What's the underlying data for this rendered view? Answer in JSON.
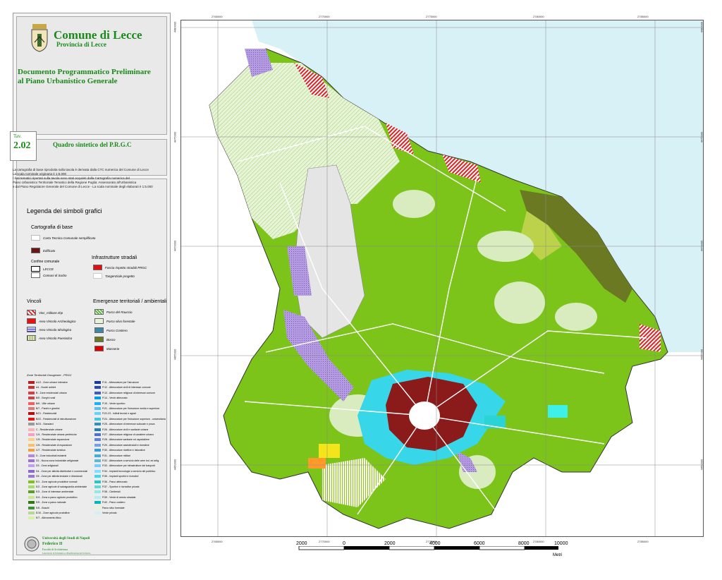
{
  "header": {
    "comune": "Comune di Lecce",
    "provincia": "Provincia di Lecce",
    "documento": "Documento Programmatico Preliminare al Piano Urbanistico Generale"
  },
  "tavola": {
    "label": "Tav.",
    "number": "2.02",
    "title": "Quadro sintetico del P.R.G.C"
  },
  "notes": {
    "line1": "La cartografia di base riprodotta sulla tavola è derivata dalla CTC numerica del Comune di Lecce",
    "line2": "La scala nominale originaria è 1:5.000",
    "line3": "I dati tematici riportati sulla tavola sono stati acquisiti dalla Cartografia numerica del",
    "line4": "Piano Urbanistico Territoriale Tematico della Regione Puglia: Assessorato all'Urbanistica",
    "line5": "e dal Piano Regolatore Generale del Comune di Lecce - La scala nominale degli elaborati è 1:5.000"
  },
  "legend": {
    "title": "Legenda dei simboli grafici",
    "cartografia": {
      "title": "Cartografia di base",
      "items": [
        "Carta Tecnica Comunale semplificata",
        "Edificato"
      ]
    },
    "confine": {
      "title": "Confine comunale",
      "items": [
        "LECCE",
        "Comuni di Surbo"
      ]
    },
    "infrastrutture": {
      "title": "Infrastrutture stradali",
      "items": [
        "Fascia rispetto stradali PRGC",
        "Tangenziale progetto"
      ]
    },
    "vincoli": {
      "title": "Vincoli",
      "items": [
        "Vinc_militare.shp",
        "Area Vincolo Archeologico",
        "Area Vincolo Idrologico",
        "Area Vincolo Paesistico"
      ]
    },
    "emergenze": {
      "title": "Emergenze territoriali / ambientali",
      "items": [
        "Parco del Rauccio",
        "Parco silvo forestale",
        "Parco Costiero",
        "Bosco",
        "Masserie"
      ]
    },
    "zone_title": "Zone Territoriali Omogenee - PRGC",
    "zone_left": [
      "A1/2 - Zone urbane intensive",
      "A4 - Nuclei antichi",
      "B - Zone residenziali urbane",
      "B/5 - Borghi rurali",
      "B/6 - Ville urbane",
      "B/7 - Parchi e giardini",
      "B/21 - Residenziali",
      "B/22 - Residenziali di ristrutturazione",
      "B/23 - Standard",
      "C - Residenziale urbane",
      "C/4 - Residenziale urbane periferiche",
      "C/5 - Residenziale espansione",
      "C/6 - Residenziale di espansione",
      "C/7 - Residenziale turistica",
      "D - Zone industriali esistenti",
      "D2 - Nuova zona industriale artigianale",
      "D3 - Zone artigianali",
      "D4 - Zone per attività distributive e commerciali",
      "D5 - Zone per attività terziarie e direzionali",
      "E/1 - Zone agricole produttive normali",
      "E/2 - Zone agricole di salvaguardia ambientale",
      "E/3 - Zone di interesse ambientale",
      "E/4 - Zona a parco agricolo produttivo",
      "E/5 - Zone a parco naturale",
      "E/6 - Boschi",
      "E/10 - Zone agricole produttive",
      "E/7 - Allevamento ittico"
    ],
    "zone_right": [
      "F/11 - Attrezzature per l'istruzione",
      "F/12 - Attrezzature civili di interesse comune",
      "F/13 - Attrezzature religiose di interesse comune",
      "F/14 - Verde attrezzato",
      "F/15 - Verde sportivo",
      "F/21 - Attrezzature per l'istruzione media e superiore",
      "F/22-23 - Istituti tecnici e agrari",
      "F/24 - Attrezzature per l'istruzione superiore - universitaria",
      "F/25 - Attrezzature di interesse culturale e prova",
      "F/26 - Attrezzature civili e sanitarie urbane",
      "F/27 - Attrezzature religiose di carattere urbano",
      "F/28 - Attrezzature sanitarie ed ospedaliere",
      "F/29 - Attrezzature assistenziali e ricreative",
      "F/30 - Attrezzature ricettive e ristorative",
      "F/31 - Attrezzature militari",
      "F/32 - Attrezzature a servizio delle aree ind. ed artig.",
      "F/33 - Attrezzature per infrastrutture dei trasporti",
      "F/34 - Impianti tecnologici a servizio del pubblico",
      "F/35 - Impianti sportivi e ricreativi",
      "F/36 - Parco attrezzato",
      "F/37 - Sportive e ricreative private",
      "F/38 - Cimiteriali",
      "F/39 - Verde di arredo stradale",
      "F/40 - Parco costiero",
      "Parco silvo forestale",
      "Verde privato"
    ]
  },
  "map": {
    "grid_x_labels": [
      "2765000",
      "2770000",
      "2775000",
      "2780000",
      "2785000"
    ],
    "grid_y_labels": [
      "4480000",
      "4475000",
      "4470000",
      "4465000",
      "4460000"
    ],
    "sea_color": "#d8f1f7",
    "agri_color": "#7cc41a",
    "light_green": "#d9ecbf",
    "historic_core": "#8b1a1a",
    "cyan_zone": "#37d6e8"
  },
  "scalebar": {
    "labels": [
      "2000",
      "0",
      "2000",
      "4000",
      "6000",
      "8000",
      "10000"
    ],
    "unit": "Metri"
  },
  "footer": {
    "university": "Università degli Studi di Napoli",
    "faculty": "Federico II",
    "dept": "Facoltà di Architettura",
    "sub": "Laboratorio di Urbanistica e Pianificazione del Territorio"
  }
}
